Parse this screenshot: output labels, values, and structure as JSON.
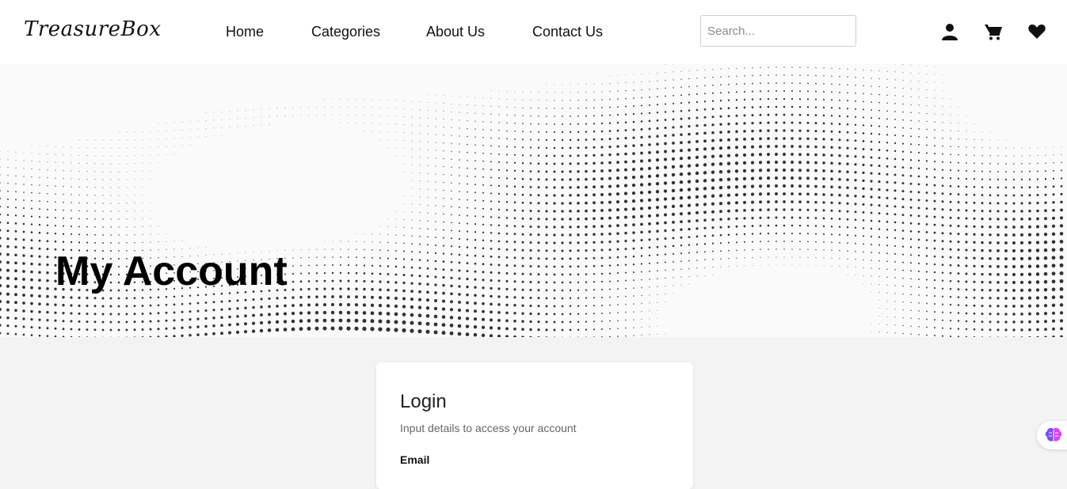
{
  "header": {
    "logo": "TreasureBox",
    "nav": [
      "Home",
      "Categories",
      "About Us",
      "Contact Us"
    ],
    "search_placeholder": "Search...",
    "icons": [
      "user-icon",
      "cart-icon",
      "heart-icon"
    ]
  },
  "hero": {
    "title": "My Account"
  },
  "login": {
    "title": "Login",
    "subtitle": "Input details to access your account",
    "email_label": "Email"
  },
  "floating": {
    "icon": "brain-icon",
    "colors": [
      "#7c4dff",
      "#e040fb"
    ]
  }
}
